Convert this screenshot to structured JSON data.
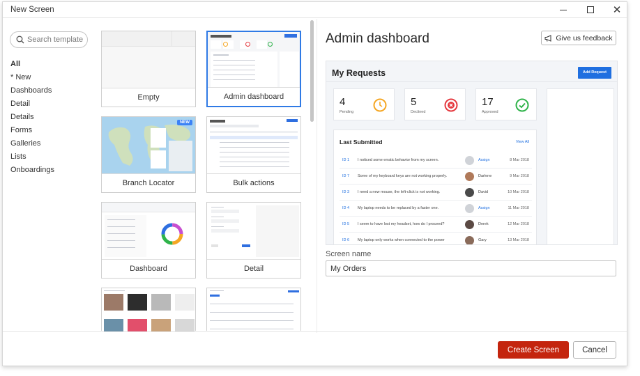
{
  "window": {
    "title": "New Screen"
  },
  "search": {
    "placeholder": "Search template"
  },
  "categories": [
    "All",
    "* New",
    "Dashboards",
    "Detail",
    "Details",
    "Forms",
    "Galleries",
    "Lists",
    "Onboardings"
  ],
  "templates": [
    {
      "label": "Empty"
    },
    {
      "label": "Admin dashboard",
      "selected": true
    },
    {
      "label": "Branch Locator",
      "badge": "NEW"
    },
    {
      "label": "Bulk actions"
    },
    {
      "label": "Dashboard"
    },
    {
      "label": "Detail"
    }
  ],
  "preview": {
    "title": "Admin dashboard",
    "feedback_label": "Give us feedback",
    "app": {
      "heading": "My Requests",
      "add_button": "Add Request",
      "stats": [
        {
          "value": "4",
          "label": "Pending",
          "color": "#f5a623"
        },
        {
          "value": "5",
          "label": "Declined",
          "color": "#e5393f"
        },
        {
          "value": "17",
          "label": "Approved",
          "color": "#2fb34a"
        }
      ],
      "list_title": "Last Submitted",
      "view_all": "View All",
      "rows": [
        {
          "id": "ID 1",
          "text": "I noticed some erratic behavior from my screen.",
          "name": "Assign",
          "date": "8 Mar 2018"
        },
        {
          "id": "ID 7",
          "text": "Some of my keyboard keys are not working properly.",
          "name": "Darlene",
          "date": "9 Mar 2018"
        },
        {
          "id": "ID 3",
          "text": "I need a new mouse, the left-click is not working.",
          "name": "David",
          "date": "10 Mar 2018"
        },
        {
          "id": "ID 4",
          "text": "My laptop needs to be replaced by a faster one.",
          "name": "Assign",
          "date": "11 Mar 2018"
        },
        {
          "id": "ID 5",
          "text": "I seem to have lost my headset, how do I proceed?",
          "name": "Derek",
          "date": "12 Mar 2018"
        },
        {
          "id": "ID 6",
          "text": "My laptop only works when connected to the power",
          "name": "Gary",
          "date": "13 Mar 2018"
        }
      ]
    }
  },
  "screen_name": {
    "label": "Screen name",
    "value": "My Orders"
  },
  "footer": {
    "create_label": "Create Screen",
    "cancel_label": "Cancel"
  },
  "colors": {
    "primary": "#c4250e",
    "selection": "#2f7ae5",
    "link": "#1f6fe0"
  }
}
